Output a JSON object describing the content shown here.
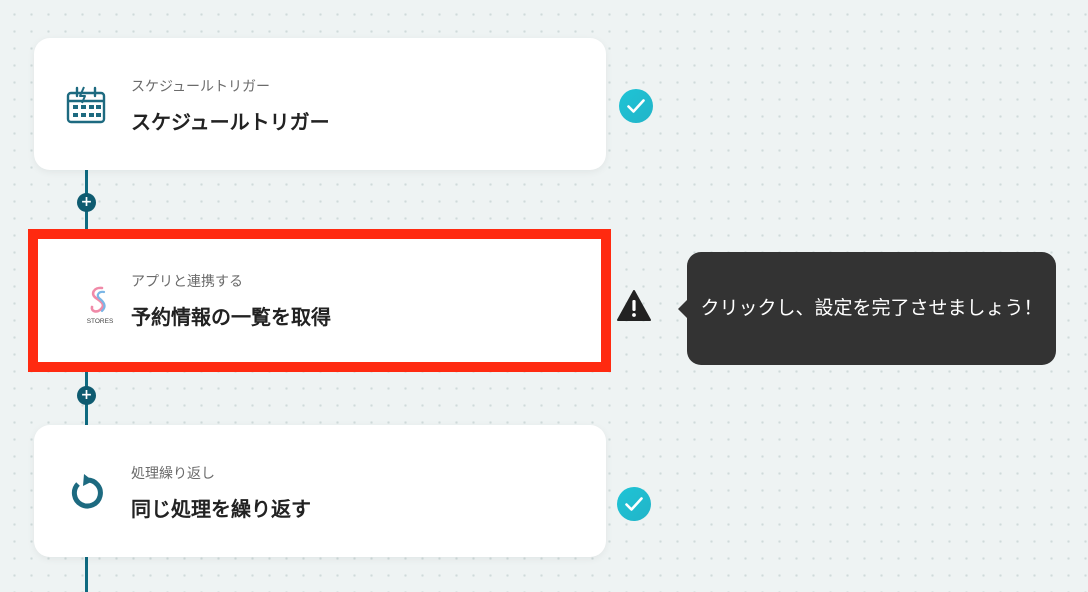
{
  "flow": {
    "steps": [
      {
        "subtitle": "スケジュールトリガー",
        "title": "スケジュールトリガー",
        "icon": "schedule-trigger-icon",
        "status": "complete"
      },
      {
        "subtitle": "アプリと連携する",
        "title": "予約情報の一覧を取得",
        "icon": "stores-logo",
        "logo_text": "STORES",
        "status": "warning"
      },
      {
        "subtitle": "処理繰り返し",
        "title": "同じ処理を繰り返す",
        "icon": "loop-icon",
        "status": "complete"
      }
    ]
  },
  "tooltip": {
    "text": "クリックし、設定を完了させましょう！"
  },
  "colors": {
    "primary": "#0e6a80",
    "check_gradient_start": "#1ec4d6",
    "check_gradient_end": "#22b4c8",
    "warning": "#222222",
    "highlight_border": "#ff2a10",
    "tooltip_bg": "#333333"
  }
}
